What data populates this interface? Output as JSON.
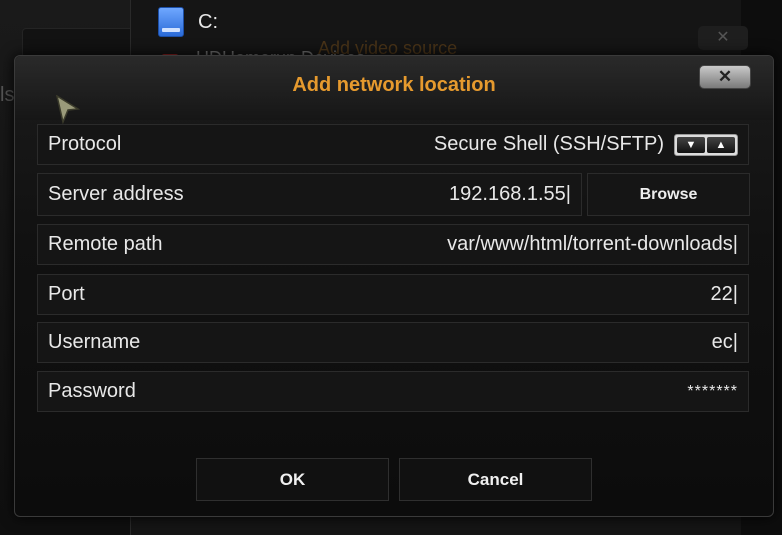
{
  "background": {
    "left_text": "ls",
    "drive_label": "C:",
    "second_item": "HDHomerun Devices",
    "ghost_title": "Add video source"
  },
  "dialog": {
    "title": "Add network location",
    "close_glyph": "✕"
  },
  "form": {
    "protocol": {
      "label": "Protocol",
      "value": "Secure Shell (SSH/SFTP)",
      "down": "▼",
      "up": "▲"
    },
    "server": {
      "label": "Server address",
      "value": "192.168.1.55|"
    },
    "browse_label": "Browse",
    "remote_path": {
      "label": "Remote path",
      "value": "var/www/html/torrent-downloads|"
    },
    "port": {
      "label": "Port",
      "value": "22|"
    },
    "username": {
      "label": "Username",
      "value": "ec|"
    },
    "password": {
      "label": "Password",
      "value": "*******"
    }
  },
  "buttons": {
    "ok": "OK",
    "cancel": "Cancel"
  },
  "colors": {
    "title": "#e69a2e",
    "background": "#0d0d0d"
  }
}
